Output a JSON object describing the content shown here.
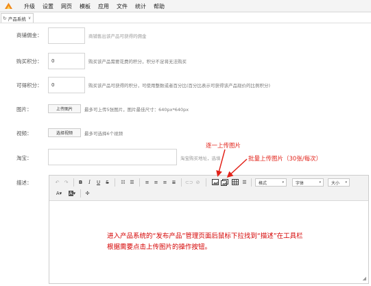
{
  "menubar": {
    "items": [
      "升级",
      "设置",
      "网页",
      "模板",
      "应用",
      "文件",
      "统计",
      "帮助"
    ]
  },
  "tab": {
    "label": "产品系统",
    "chevron": "∨"
  },
  "form": {
    "commission": {
      "label": "商铺佣金：",
      "value": "",
      "hint": "商铺售出该产品可获得的佣金"
    },
    "buy_points": {
      "label": "购买积分：",
      "value": "0",
      "hint": "购买该产品需要花费的积分，积分不足将无法购买"
    },
    "earn_points": {
      "label": "可得积分：",
      "value": "0",
      "hint": "购买该产品可获得的积分，可使用整数或者百分比(百分比表示可获得该产品现价的比例积分)"
    },
    "image": {
      "label": "图片：",
      "button": "上传图片",
      "hint": "最多可上传5张图片，图片最佳尺寸：640px*640px"
    },
    "video": {
      "label": "视频：",
      "button": "选择视频",
      "hint": "最多可选择6个视频"
    },
    "taobao": {
      "label": "淘宝：",
      "value": "",
      "hint": "淘宝购买地址，选填"
    },
    "description": {
      "label": "描述："
    }
  },
  "editor": {
    "dropdowns": {
      "format": "格式",
      "font": "字体",
      "size": "大小"
    },
    "content": "进入产品系统的“发布产品”管理页面后鼠标下拉找到“描述”在工具栏\n根据需要点击上传图片的操作按钮。"
  },
  "annotations": {
    "single_upload": "逐一上传图片",
    "batch_upload": "批量上传图片（30张/每次）"
  },
  "colors": {
    "annotation": "#e2231a",
    "note": "#d40000"
  }
}
